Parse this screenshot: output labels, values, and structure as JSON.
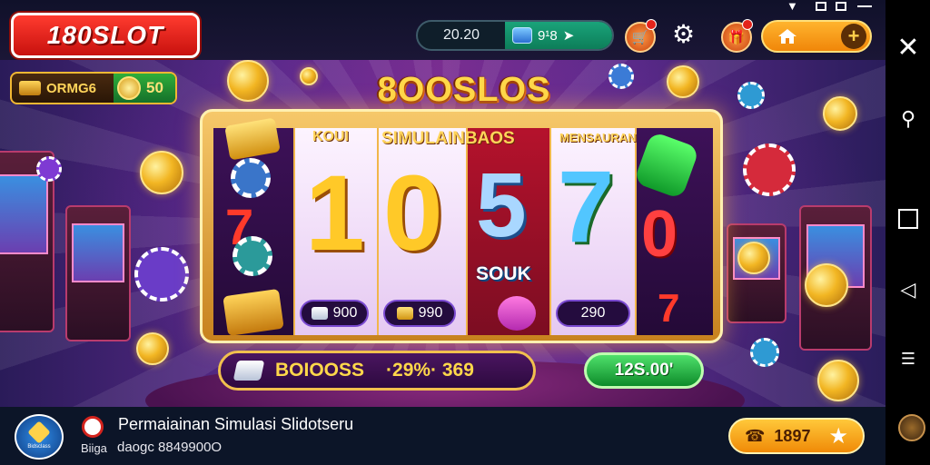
{
  "header": {
    "logo_text": "180SLOT",
    "time_label": "20.20",
    "gem_count": "9¹8",
    "home_plus": "+"
  },
  "game": {
    "title": "8OOSLOS",
    "reel_labels": [
      "KOUI",
      "SIMULAINBAOS",
      "MENSAURAN"
    ],
    "reel_numbers": [
      "1",
      "0",
      "5",
      "7",
      "0"
    ],
    "sock_label": "SOUK",
    "reel_values": [
      "900",
      "990",
      "290"
    ],
    "bonus_label": "BOIOOSS",
    "bonus_value": "·29%· 369",
    "win_value": "12S.00'",
    "balance_label": "ORMG6",
    "balance_value": "50"
  },
  "ad": {
    "icon_caption": "Bidsclass",
    "title": "Permaiainan Simulasi Slidotseru",
    "sub_left": "Biiga",
    "sub_right": "daogc 8849900O",
    "cta_value": "1897"
  },
  "colors": {
    "accent_orange": "#f08a07",
    "logo_red": "#d4231d",
    "win_green": "#0d8b2a"
  }
}
